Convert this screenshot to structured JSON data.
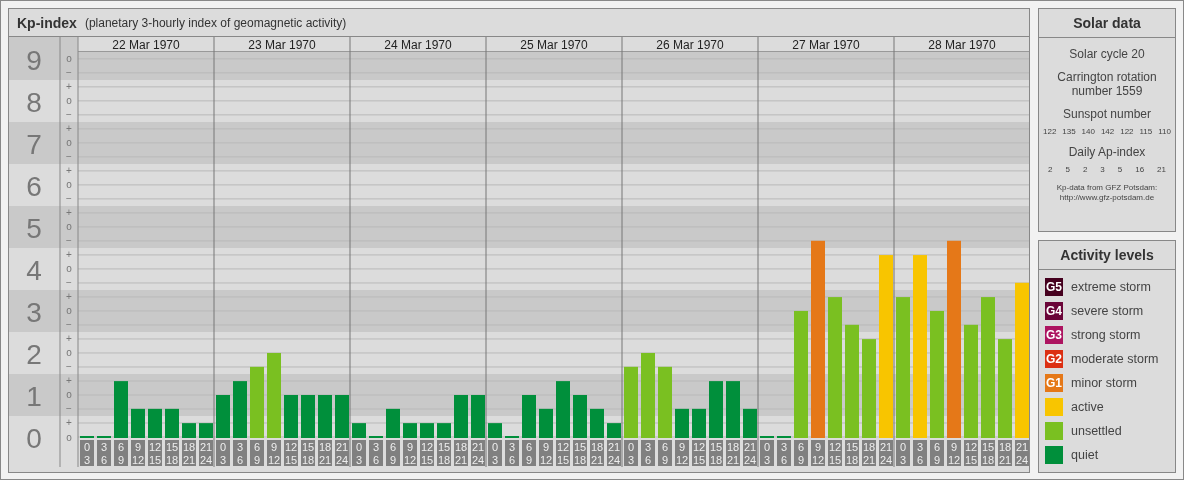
{
  "kp_panel": {
    "title": "Kp-index",
    "subtitle": "(planetary 3-hourly index of geomagnetic activity)",
    "y_sub_labels": [
      "o",
      "−",
      "+",
      "o",
      "−",
      "+",
      "o",
      "−",
      "+",
      "o",
      "−",
      "+",
      "o",
      "−",
      "+",
      "o",
      "−",
      "+",
      "o",
      "−",
      "+",
      "o",
      "−",
      "+",
      "o",
      "−",
      "+",
      "o"
    ],
    "days": [
      {
        "date": "22 Mar 1970",
        "slots": [
          {
            "from": "0",
            "to": "3"
          },
          {
            "from": "3",
            "to": "6"
          },
          {
            "from": "6",
            "to": "9"
          },
          {
            "from": "9",
            "to": "12"
          },
          {
            "from": "12",
            "to": "15"
          },
          {
            "from": "15",
            "to": "18"
          },
          {
            "from": "18",
            "to": "21"
          },
          {
            "from": "21",
            "to": "24"
          }
        ]
      },
      {
        "date": "23 Mar 1970",
        "slots": [
          {
            "from": "0",
            "to": "3"
          },
          {
            "from": "3",
            "to": "6"
          },
          {
            "from": "6",
            "to": "9"
          },
          {
            "from": "9",
            "to": "12"
          },
          {
            "from": "12",
            "to": "15"
          },
          {
            "from": "15",
            "to": "18"
          },
          {
            "from": "18",
            "to": "21"
          },
          {
            "from": "21",
            "to": "24"
          }
        ]
      },
      {
        "date": "24 Mar 1970",
        "slots": [
          {
            "from": "0",
            "to": "3"
          },
          {
            "from": "3",
            "to": "6"
          },
          {
            "from": "6",
            "to": "9"
          },
          {
            "from": "9",
            "to": "12"
          },
          {
            "from": "12",
            "to": "15"
          },
          {
            "from": "15",
            "to": "18"
          },
          {
            "from": "18",
            "to": "21"
          },
          {
            "from": "21",
            "to": "24"
          }
        ]
      },
      {
        "date": "25 Mar 1970",
        "slots": [
          {
            "from": "0",
            "to": "3"
          },
          {
            "from": "3",
            "to": "6"
          },
          {
            "from": "6",
            "to": "9"
          },
          {
            "from": "9",
            "to": "12"
          },
          {
            "from": "12",
            "to": "15"
          },
          {
            "from": "15",
            "to": "18"
          },
          {
            "from": "18",
            "to": "21"
          },
          {
            "from": "21",
            "to": "24"
          }
        ]
      },
      {
        "date": "26 Mar 1970",
        "slots": [
          {
            "from": "0",
            "to": "3"
          },
          {
            "from": "3",
            "to": "6"
          },
          {
            "from": "6",
            "to": "9"
          },
          {
            "from": "9",
            "to": "12"
          },
          {
            "from": "12",
            "to": "15"
          },
          {
            "from": "15",
            "to": "18"
          },
          {
            "from": "18",
            "to": "21"
          },
          {
            "from": "21",
            "to": "24"
          }
        ]
      },
      {
        "date": "27 Mar 1970",
        "slots": [
          {
            "from": "0",
            "to": "3"
          },
          {
            "from": "3",
            "to": "6"
          },
          {
            "from": "6",
            "to": "9"
          },
          {
            "from": "9",
            "to": "12"
          },
          {
            "from": "12",
            "to": "15"
          },
          {
            "from": "15",
            "to": "18"
          },
          {
            "from": "18",
            "to": "21"
          },
          {
            "from": "21",
            "to": "24"
          }
        ]
      },
      {
        "date": "28 Mar 1970",
        "slots": [
          {
            "from": "0",
            "to": "3"
          },
          {
            "from": "3",
            "to": "6"
          },
          {
            "from": "6",
            "to": "9"
          },
          {
            "from": "9",
            "to": "12"
          },
          {
            "from": "12",
            "to": "15"
          },
          {
            "from": "15",
            "to": "18"
          },
          {
            "from": "18",
            "to": "21"
          },
          {
            "from": "21",
            "to": "24"
          }
        ]
      }
    ],
    "chart_data": {
      "type": "bar",
      "grid": true,
      "ylim": [
        0,
        9.52
      ],
      "yticks": [
        0,
        1,
        2,
        3,
        4,
        5,
        6,
        7,
        8,
        9
      ],
      "values": [
        0,
        0,
        1.33,
        0.67,
        0.67,
        0.67,
        0.33,
        0.33,
        1,
        1.33,
        1.67,
        2,
        1,
        1,
        1,
        1,
        0.33,
        0,
        0.67,
        0.33,
        0.33,
        0.33,
        1,
        1,
        0.33,
        0,
        1,
        0.67,
        1.33,
        1,
        0.67,
        0.33,
        1.67,
        2,
        1.67,
        0.67,
        0.67,
        1.33,
        1.33,
        0.67,
        0,
        0,
        3,
        4.67,
        3.33,
        2.67,
        2.33,
        4.33,
        3.33,
        4.33,
        3,
        4.67,
        2.67,
        3.33,
        2.33,
        3.67
      ]
    }
  },
  "solar_data": {
    "title": "Solar data",
    "solar_cycle": "Solar cycle 20",
    "carrington": "Carrington rotation number 1559",
    "sunspot_title": "Sunspot number",
    "sunspot_numbers": [
      "122",
      "135",
      "140",
      "142",
      "122",
      "115",
      "110"
    ],
    "ap_title": "Daily Ap-index",
    "ap_values": [
      "2",
      "5",
      "2",
      "3",
      "5",
      "16",
      "21"
    ],
    "source_lines": [
      "Kp-data from GFZ Potsdam:",
      "http://www.gfz-potsdam.de"
    ]
  },
  "legend": {
    "title": "Activity levels",
    "items": [
      {
        "badge": "G5",
        "label": "extreme storm",
        "color": "#45001e"
      },
      {
        "badge": "G4",
        "label": "severe storm",
        "color": "#6a0438"
      },
      {
        "badge": "G3",
        "label": "strong storm",
        "color": "#ad1460"
      },
      {
        "badge": "G2",
        "label": "moderate storm",
        "color": "#dc2f12"
      },
      {
        "badge": "G1",
        "label": "minor storm",
        "color": "#e57818"
      },
      {
        "label": "active",
        "color": "#f8c500"
      },
      {
        "label": "unsettled",
        "color": "#7ac021"
      },
      {
        "label": "quiet",
        "color": "#008f3b"
      }
    ]
  }
}
